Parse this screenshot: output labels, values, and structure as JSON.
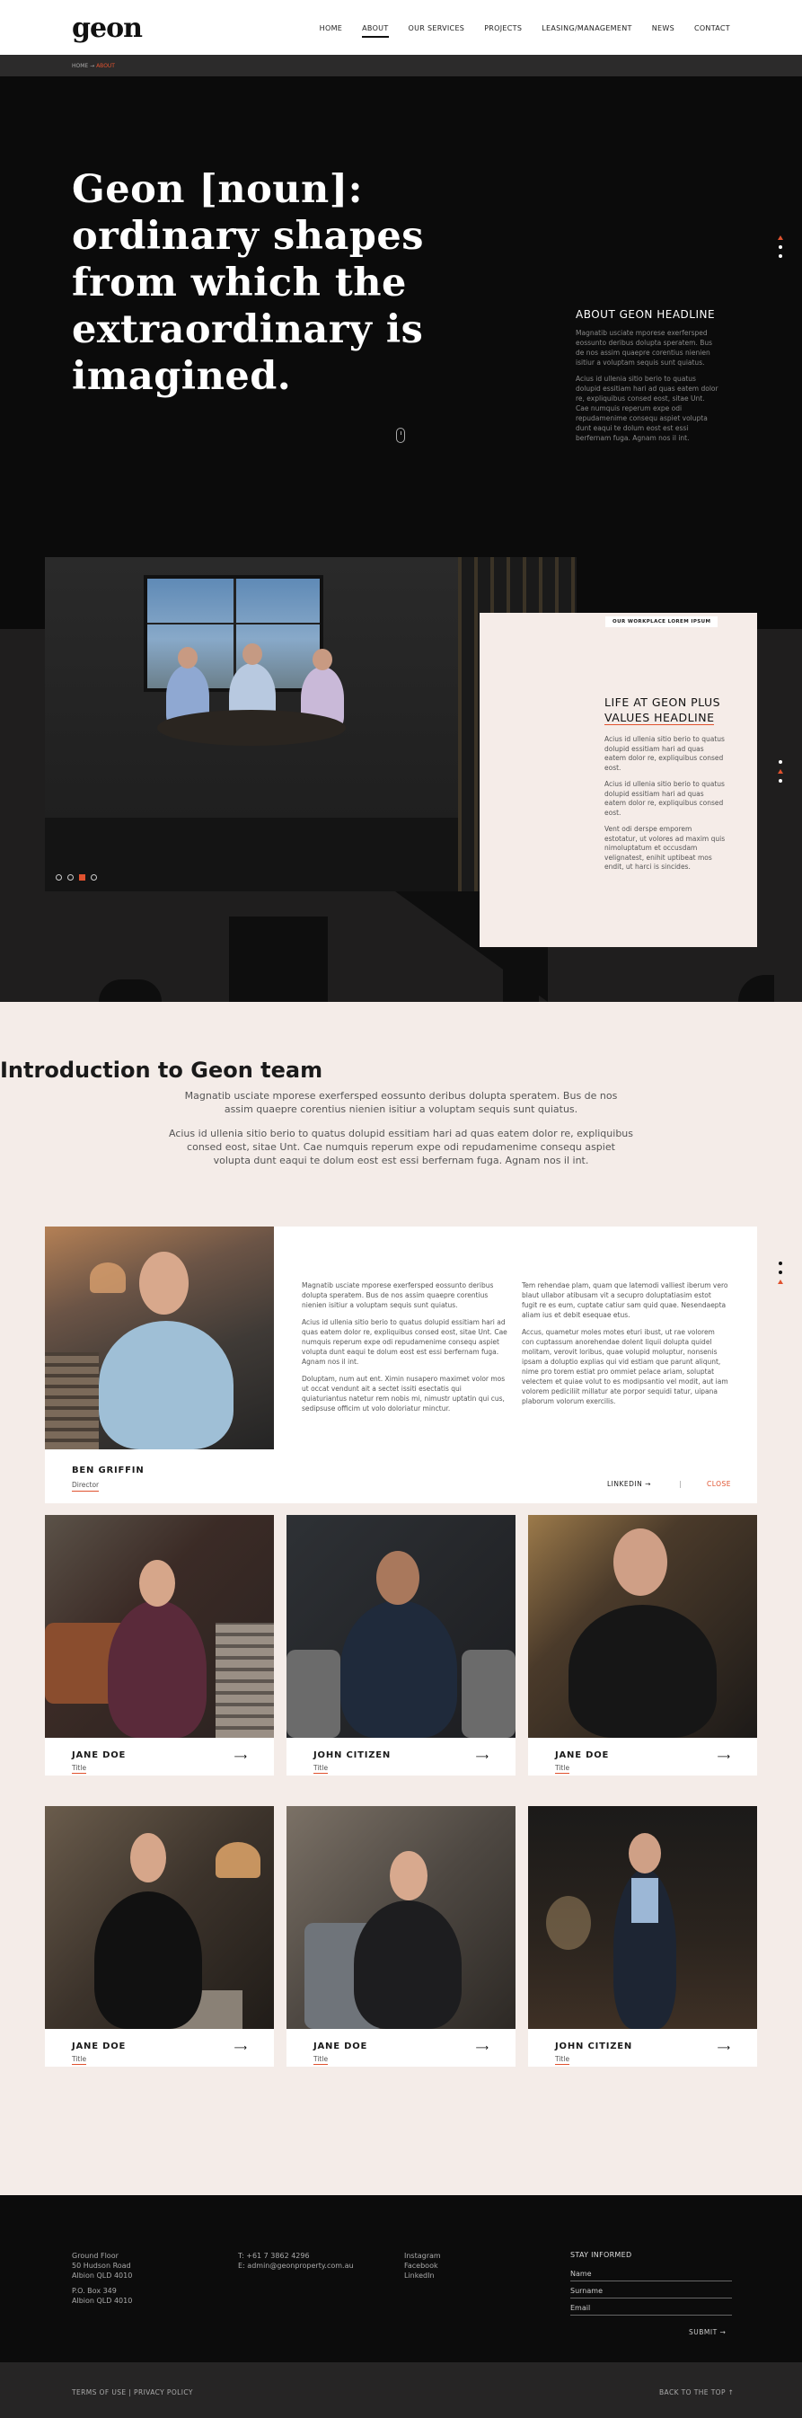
{
  "header": {
    "logo": "geon",
    "nav": [
      "HOME",
      "ABOUT",
      "OUR SERVICES",
      "PROJECTS",
      "LEASING/MANAGEMENT",
      "NEWS",
      "CONTACT"
    ],
    "active": "ABOUT"
  },
  "breadcrumb": {
    "home": "HOME",
    "sep": "→",
    "current": "ABOUT"
  },
  "hero": {
    "headline": "Geon [noun]: ordinary shapes from which the extraordinary is imagined.",
    "side_title": "ABOUT GEON HEADLINE",
    "side_p1": "Magnatib usciate mporese exerfersped eossunto deribus dolupta speratem. Bus de nos assim quaepre corentius nienien isitiur a voluptam sequis sunt quiatus.",
    "side_p2": "Acius id ullenia sitio berio to quatus dolupid essitiam hari ad quas eatem dolor re, expliquibus consed eost, sitae Unt. Cae numquis reperum expe odi repudamenime consequ aspiet volupta dunt eaqui te dolum eost est essi berfernam fuga. Agnam nos il int."
  },
  "life": {
    "chip": "OUR WORKPLACE LOREM IPSUM",
    "title_line1": "LIFE AT GEON PLUS",
    "title_line2": "VALUES HEADLINE",
    "p1": "Acius id ullenia sitio berio to quatus dolupid essitiam hari ad quas eatem dolor re, expliquibus consed eost.",
    "p2": "Acius id ullenia sitio berio to quatus dolupid essitiam hari ad quas eatem dolor re, expliquibus consed eost.",
    "p3": "Vent odi derspe emporem estotatur, ut volores ad maxim quis nimoluptatum et occusdam velignatest, enihit uptibeat mos endit, ut harci is sincides.",
    "prev": "◂",
    "next": "▸"
  },
  "intro": {
    "title": "Introduction to Geon team",
    "p1": "Magnatib usciate mporese exerfersped eossunto deribus dolupta speratem. Bus de nos assim quaepre corentius nienien isitiur a voluptam sequis sunt quiatus.",
    "p2": "Acius id ullenia sitio berio to quatus dolupid essitiam hari ad quas eatem dolor re, expliquibus consed eost, sitae Unt. Cae numquis reperum expe odi repudamenime consequ aspiet volupta dunt eaqui te dolum eost est essi berfernam fuga. Agnam nos il int."
  },
  "featured": {
    "name": "BEN GRIFFIN",
    "role": "Director",
    "c1p1": "Magnatib usciate mporese exerfersped eossunto deribus dolupta speratem. Bus de nos assim quaepre corentius nienien isitiur a voluptam sequis sunt quiatus.",
    "c1p2": "Acius id ullenia sitio berio to quatus dolupid essitiam hari ad quas eatem dolor re, expliquibus consed eost, sitae Unt. Cae numquis reperum expe odi repudamenime consequ aspiet volupta dunt eaqui te dolum eost est essi berfernam fuga. Agnam nos il int.",
    "c1p3": "Doluptam, num aut ent. Ximin nusapero maximet volor mos ut occat vendunt ait a sectet issiti esectatis qui quiaturiantus natetur rem nobis mi, nimustr uptatin qui cus, sedipsuse officim ut volo doloriatur minctur.",
    "c2p1": "Tem rehendae plam, quam que latemodi valliest iberum vero blaut ullabor atibusam vit a secupro doluptatiasim estot fugit re es eum, cuptate catiur sam quid quae. Nesendaepta aliam ius et debit esequae etus.",
    "c2p2": "Accus, quametur moles motes eturi ibust, ut rae volorem con cuptassum anorehendae dolent liquii dolupta quidel molitam, verovit loribus, quae volupid moluptur, nonsenis ipsam a doluptio explias qui vid estiam que parunt aliqunt, nime pro torem estiat pro ommiet pelace ariam, soluptat velectem et quiae volut to es modipsantio vel modit, aut iam volorem pediciliit millatur ate porpor sequidi tatur, uipana plaborum volorum exercilis.",
    "linkedin": "LINKEDIN →",
    "sep": "|",
    "close": "CLOSE"
  },
  "team": [
    {
      "name": "JANE DOE",
      "title": "Title"
    },
    {
      "name": "JOHN CITIZEN",
      "title": "Title"
    },
    {
      "name": "JANE DOE",
      "title": "Title"
    },
    {
      "name": "JANE DOE",
      "title": "Title"
    },
    {
      "name": "JANE DOE",
      "title": "Title"
    },
    {
      "name": "JOHN CITIZEN",
      "title": "Title"
    }
  ],
  "footer": {
    "addr1": "Ground Floor",
    "addr2": "50 Hudson Road",
    "addr3": "Albion QLD 4010",
    "po1": "P.O. Box 349",
    "po2": "Albion QLD 4010",
    "phone": "T: +61 7 3862 4296",
    "email": "E: admin@geonproperty.com.au",
    "social1": "Instagram",
    "social2": "Facebook",
    "social3": "LinkedIn",
    "stay": "STAY INFORMED",
    "f_name": "Name",
    "f_surname": "Surname",
    "f_email": "Email",
    "submit": "SUBMIT →",
    "terms": "TERMS OF USE  |  PRIVACY POLICY",
    "top": "BACK TO THE TOP  ↑"
  },
  "colors": {
    "accent": "#e0522f",
    "dark": "#0b0b0b",
    "blush": "#f4ece8"
  }
}
